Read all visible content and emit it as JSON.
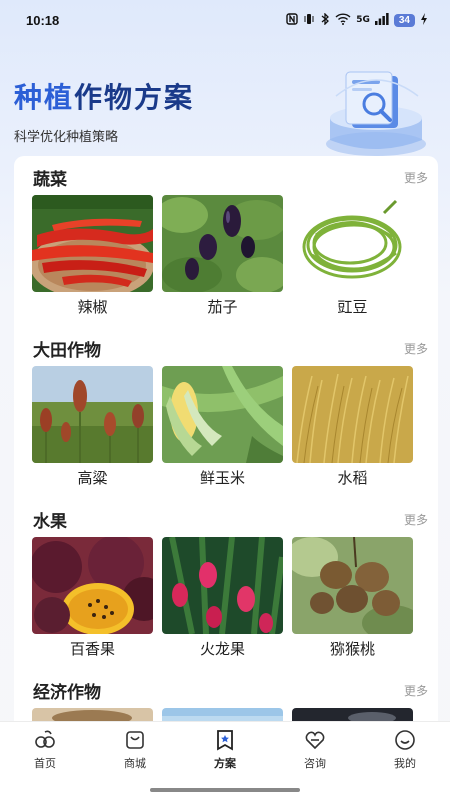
{
  "status": {
    "time": "10:18",
    "network": "5G",
    "battery": "34"
  },
  "hero": {
    "title_accent": "种植",
    "title_rest": "作物方案",
    "subtitle": "科学优化种植策略"
  },
  "sections": [
    {
      "title": "蔬菜",
      "more": "更多",
      "items": [
        {
          "label": "辣椒",
          "icon": "chili-pepper-photo"
        },
        {
          "label": "茄子",
          "icon": "eggplant-photo"
        },
        {
          "label": "豇豆",
          "icon": "cowpea-photo"
        }
      ]
    },
    {
      "title": "大田作物",
      "more": "更多",
      "items": [
        {
          "label": "高粱",
          "icon": "sorghum-photo"
        },
        {
          "label": "鲜玉米",
          "icon": "corn-photo"
        },
        {
          "label": "水稻",
          "icon": "rice-photo"
        }
      ]
    },
    {
      "title": "水果",
      "more": "更多",
      "items": [
        {
          "label": "百香果",
          "icon": "passion-fruit-photo"
        },
        {
          "label": "火龙果",
          "icon": "dragon-fruit-photo"
        },
        {
          "label": "猕猴桃",
          "icon": "kiwi-photo"
        }
      ]
    },
    {
      "title": "经济作物",
      "more": "更多",
      "items": []
    }
  ],
  "tabs": [
    {
      "label": "首页",
      "icon": "home-icon",
      "active": false
    },
    {
      "label": "商城",
      "icon": "shop-icon",
      "active": false
    },
    {
      "label": "方案",
      "icon": "plan-icon",
      "active": true
    },
    {
      "label": "咨询",
      "icon": "consult-icon",
      "active": false
    },
    {
      "label": "我的",
      "icon": "profile-icon",
      "active": false
    }
  ],
  "colors": {
    "accent": "#2c5fd6",
    "title_dark": "#1a3a8a",
    "more": "#999999"
  }
}
